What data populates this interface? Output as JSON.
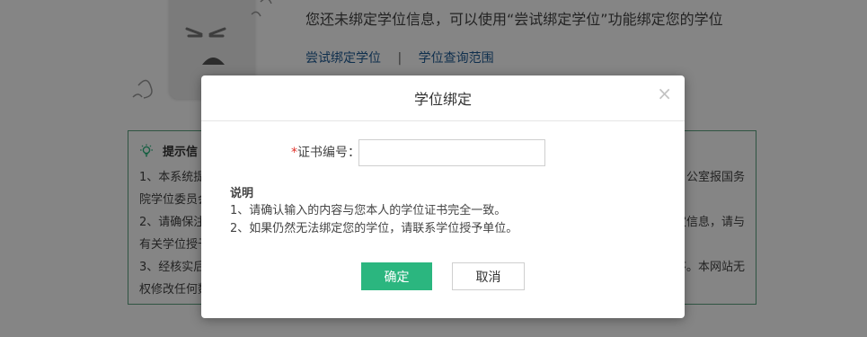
{
  "background": {
    "notice_text": "您还未绑定学位信息，可以使用“尝试绑定学位”功能绑定您的学位",
    "links": {
      "try_bind": "尝试绑定学位",
      "separator": "|",
      "query_scope": "学位查询范围"
    },
    "tips": {
      "title": "提示信",
      "items": [
        {
          "line1": "1、本系统提",
          "line2": "院学位委员会",
          "right1": "公室报国务"
        },
        {
          "line1": "2、请确保注",
          "line2": "有关学位授予",
          "right1": "定信息，请与"
        },
        {
          "line1": "3、经核实后",
          "line2": "权修改任何数",
          "right1": "序。本网站无"
        }
      ]
    }
  },
  "modal": {
    "title": "学位绑定",
    "close_glyph": "×",
    "field": {
      "required_mark": "*",
      "label": "证书编号：",
      "value": "",
      "placeholder": ""
    },
    "explain": {
      "heading": "说明",
      "lines": [
        "1、请确认输入的内容与您本人的学位证书完全一致。",
        "2、如果仍然无法绑定您的学位，请联系学位授予单位。"
      ]
    },
    "buttons": {
      "ok": "确定",
      "cancel": "取消"
    }
  },
  "colors": {
    "primary_button": "#2bb67f",
    "link": "#1d5a95",
    "tips_border": "#5aa17f",
    "required": "#e0322a",
    "overlay": "rgba(0,0,0,0.48)"
  },
  "icons": {
    "tips": "lightbulb-icon",
    "close": "close-icon",
    "illustration": "sad-face-illustration"
  }
}
